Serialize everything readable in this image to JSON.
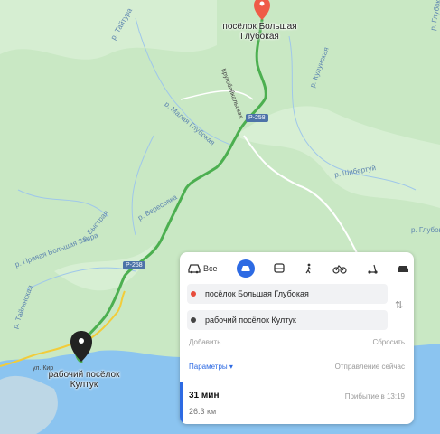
{
  "map": {
    "colors": {
      "forest": "#c9e8c4",
      "water": "#8bc4f0",
      "route": "#4caf50",
      "road": "#f2cc3a"
    },
    "start_label": "поселок Большая Глубокая",
    "start_label_lines": [
      "посёлок Большая",
      "Глубокая"
    ],
    "end_label_lines": [
      "рабочий посёлок",
      "Култук"
    ],
    "road_badges": [
      "Р-258",
      "Р-258"
    ],
    "road_name_top": "Кругобайкальская",
    "road_name_bottom": "ул. Кир",
    "place_labels": [
      "р. Тайтура",
      "р. Малая Глубокая",
      "р. Вересовка",
      "р. Правая Большая Заира",
      "р. Шибертуй",
      "р. Кулунская",
      "р. Глубока",
      "р. Глубока",
      "р. Быстрая",
      "р. Тайгинская"
    ]
  },
  "panel": {
    "modes": [
      {
        "icon": "car-icon",
        "label": "Все"
      },
      {
        "icon": "car-active-icon",
        "label": ""
      },
      {
        "icon": "bus-icon",
        "label": ""
      },
      {
        "icon": "walk-icon",
        "label": ""
      },
      {
        "icon": "bike-icon",
        "label": ""
      },
      {
        "icon": "scooter-icon",
        "label": ""
      },
      {
        "icon": "taxi-icon",
        "label": ""
      }
    ],
    "from": "посёлок Большая Глубокая",
    "to": "рабочий посёлок Култук",
    "from_color": "#e74c3c",
    "to_color": "#444444",
    "add": "Добавить",
    "reset": "Сбросить",
    "params": "Параметры ▾",
    "depart": "Отправление сейчас",
    "duration": "31 мин",
    "distance": "26.3 км",
    "arrival": "Прибытие в 13:19"
  }
}
